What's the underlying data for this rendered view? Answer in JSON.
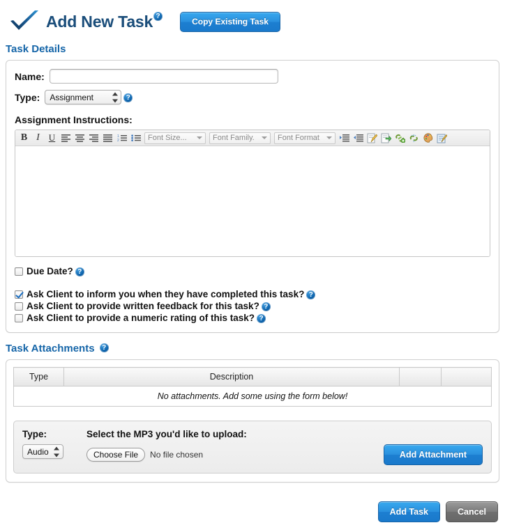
{
  "header": {
    "logo_icon": "blue-checkmark-logo",
    "title": "Add New Task",
    "help_icon": "help-question-icon",
    "copy_button": "Copy Existing Task"
  },
  "task_details": {
    "heading": "Task Details",
    "name_label": "Name:",
    "name_value": "",
    "name_placeholder": "",
    "type_label": "Type:",
    "type_value": "Assignment",
    "type_options": [
      "Assignment"
    ],
    "type_help_icon": "help-question-icon",
    "instructions_label": "Assignment Instructions:",
    "editor": {
      "content": "",
      "toolbar": {
        "bold": "B",
        "italic": "I",
        "underline": "U",
        "align_left_icon": "align-left-icon",
        "align_center_icon": "align-center-icon",
        "align_right_icon": "align-right-icon",
        "align_justify_icon": "align-justify-icon",
        "ordered_list_icon": "ordered-list-icon",
        "unordered_list_icon": "unordered-list-icon",
        "font_size": "Font Size...",
        "font_family": "Font Family.",
        "font_format": "Font Format",
        "indent_icon": "indent-icon",
        "outdent_icon": "outdent-icon",
        "edit_page_icon": "edit-page-icon",
        "insert_image_icon": "insert-image-icon",
        "insert_link_icon": "insert-link-icon",
        "unlink_icon": "unlink-icon",
        "color_palette_icon": "color-palette-icon",
        "source_edit_icon": "source-edit-icon"
      }
    },
    "checkboxes": [
      {
        "label": "Due Date?",
        "checked": false,
        "help_icon": "help-question-icon"
      },
      {
        "label": "Ask Client to inform you when they have completed this task?",
        "checked": true,
        "help_icon": "help-question-icon"
      },
      {
        "label": "Ask Client to provide written feedback for this task?",
        "checked": false,
        "help_icon": "help-question-icon"
      },
      {
        "label": "Ask Client to provide a numeric rating of this task?",
        "checked": false,
        "help_icon": "help-question-icon"
      }
    ]
  },
  "task_attachments": {
    "heading": "Task Attachments",
    "help_icon": "help-question-icon",
    "table": {
      "columns": [
        "Type",
        "Description",
        "",
        ""
      ],
      "empty_message": "No attachments. Add some using the form below!"
    },
    "upload": {
      "type_label": "Type:",
      "type_value": "Audio",
      "type_options": [
        "Audio"
      ],
      "file_prompt": "Select the MP3 you'd like to upload:",
      "choose_file_label": "Choose File",
      "no_file_text": "No file chosen",
      "add_button": "Add Attachment"
    }
  },
  "footer": {
    "submit_label": "Add Task",
    "cancel_label": "Cancel"
  },
  "colors": {
    "accent_blue": "#1565a8",
    "button_blue": "#2a8fdd",
    "title_blue": "#1a4d7a",
    "logo_dark": "#123a63",
    "logo_light": "#2b8fd0",
    "grey_button": "#7d7d7d"
  }
}
